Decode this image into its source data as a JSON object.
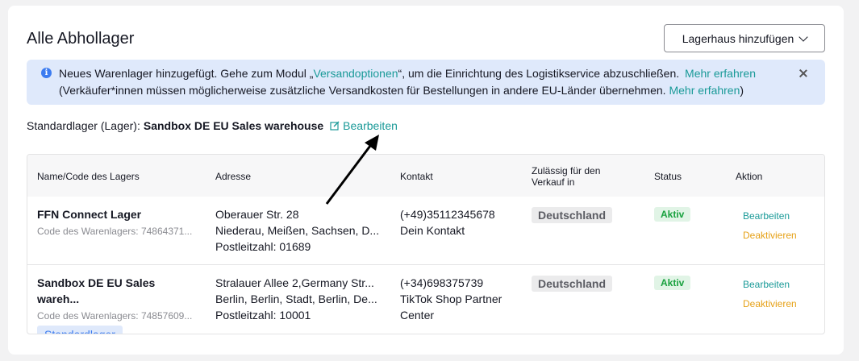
{
  "header": {
    "title": "Alle Abhollager",
    "add_button_label": "Lagerhaus hinzufügen"
  },
  "banner": {
    "text_before": "Neues Warenlager hinzugefügt. Gehe zum Modul „",
    "link_versand": "Versandoptionen",
    "text_after": "“, um die Einrichtung des Logistikservice abzuschließen.",
    "learn_more_1": "Mehr erfahren",
    "line2_text": "(Verkäufer*innen müssen möglicherweise zusätzliche Versandkosten für Bestellungen in andere EU-Länder übernehmen.",
    "learn_more_2": "Mehr erfahren",
    "line2_end": ")"
  },
  "default_warehouse": {
    "label": "Standardlager (Lager):",
    "name": "Sandbox DE EU Sales warehouse",
    "edit_label": "Bearbeiten"
  },
  "table": {
    "headers": {
      "name": "Name/Code des Lagers",
      "address": "Adresse",
      "contact": "Kontakt",
      "allowed_1": "Zulässig für den",
      "allowed_2": "Verkauf in",
      "status": "Status",
      "action": "Aktion"
    },
    "rows": [
      {
        "name": "FFN Connect Lager",
        "code": "Code des Warenlagers: 74864371...",
        "address_1": "Oberauer Str. 28",
        "address_2": "Niederau, Meißen, Sachsen, D...",
        "address_3": "Postleitzahl: 01689",
        "contact_1": "(+49)35112345678",
        "contact_2": "Dein Kontakt",
        "country": "Deutschland",
        "status": "Aktiv",
        "edit": "Bearbeiten",
        "deactivate": "Deaktivieren"
      },
      {
        "name": "Sandbox DE EU Sales wareh...",
        "code": "Code des Warenlagers: 74857609...",
        "tag": "Standardlager",
        "address_1": "Stralauer Allee 2,Germany Str...",
        "address_2": "Berlin, Berlin, Stadt, Berlin, De...",
        "address_3": "Postleitzahl: 10001",
        "contact_1": "(+34)698375739",
        "contact_2": "TikTok Shop Partner",
        "contact_3": "Center",
        "country": "Deutschland",
        "status": "Aktiv",
        "edit": "Bearbeiten",
        "deactivate": "Deaktivieren"
      }
    ]
  },
  "colors": {
    "link": "#1a9a98",
    "deactivate": "#e6a117",
    "status_green": "#18a13e",
    "banner_bg": "#dfe9fb",
    "info_blue": "#3b7bf0"
  },
  "icons": [
    "info-icon",
    "close-icon",
    "edit-icon",
    "chevron-down-icon",
    "annotation-arrow"
  ]
}
